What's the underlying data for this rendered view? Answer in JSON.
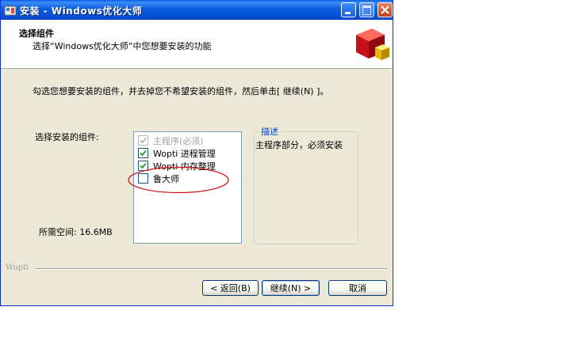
{
  "window": {
    "title": "安装 - Windows优化大师",
    "controls": [
      "minimize",
      "maximize",
      "close"
    ]
  },
  "header": {
    "title": "选择组件",
    "subtitle": "选择“Windows优化大师”中您想要安装的功能",
    "logo_icon": "installer-box-icon"
  },
  "instruction": "勾选您想要安装的组件，并去掉您不希望安装的组件，然后单击[ 继续(N) ]。",
  "components": {
    "label": "选择安装的组件:",
    "items": [
      {
        "label": "主程序(必须)",
        "checked": true,
        "disabled": true
      },
      {
        "label": "Wopti 进程管理",
        "checked": true,
        "disabled": false
      },
      {
        "label": "Wopti 内存整理",
        "checked": true,
        "disabled": false
      },
      {
        "label": "鲁大师",
        "checked": false,
        "disabled": false
      }
    ]
  },
  "description": {
    "legend": "描述",
    "text": "主程序部分，必须安装"
  },
  "space_required": "所需空间: 16.6MB",
  "brand": "Wopti",
  "buttons": {
    "back": "< 返回(B)",
    "next": "继续(N) >",
    "cancel": "取消"
  },
  "colors": {
    "titlebar": "#0a5ce0",
    "window_bg": "#ece9d8",
    "annotation": "#d01010",
    "legend": "#0046d5"
  }
}
